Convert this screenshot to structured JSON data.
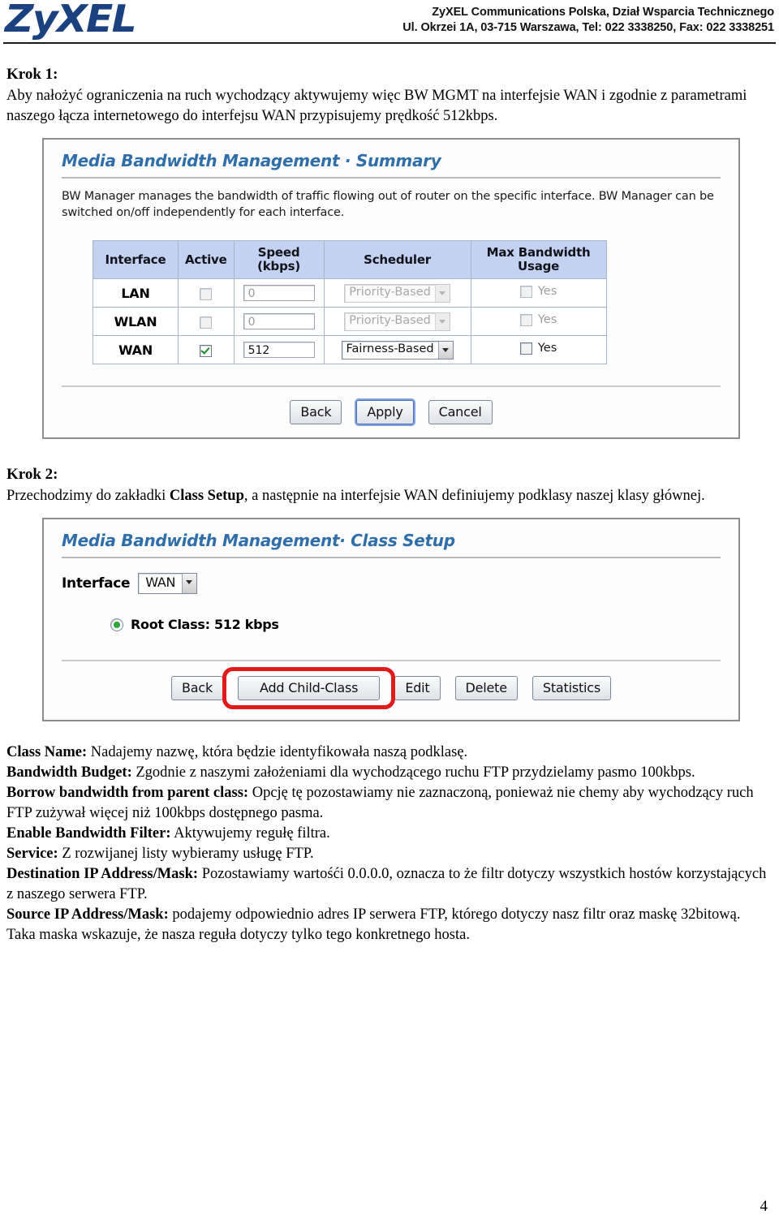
{
  "letterhead": {
    "logo_text": "ZyXEL",
    "logo_color": "#1b4180",
    "company_line1": "ZyXEL Communications Polska, Dział Wsparcia Technicznego",
    "company_line2": "Ul. Okrzei 1A, 03-715 Warszawa, Tel: 022 3338250, Fax: 022 3338251"
  },
  "step1": {
    "heading": "Krok 1:",
    "body": "Aby nałożyć ograniczenia na ruch wychodzący aktywujemy więc BW MGMT na interfejsie WAN i zgodnie z parametrami naszego łącza internetowego do interfejsu WAN przypisujemy prędkość 512kbps."
  },
  "summary_screen": {
    "title": "Media Bandwidth Management · Summary",
    "description": "BW Manager manages the bandwidth of traffic flowing out of router on the specific interface. BW Manager can be switched on/off independently for each interface.",
    "table": {
      "headers": [
        "Interface",
        "Active",
        "Speed (kbps)",
        "Scheduler",
        "Max Bandwidth Usage"
      ],
      "rows": [
        {
          "interface": "LAN",
          "active": false,
          "speed": "0",
          "speed_disabled": true,
          "scheduler": "Priority-Based",
          "scheduler_disabled": true,
          "max_bandwidth_label": "Yes",
          "max_bandwidth_checked": false,
          "max_bandwidth_disabled": true
        },
        {
          "interface": "WLAN",
          "active": false,
          "speed": "0",
          "speed_disabled": true,
          "scheduler": "Priority-Based",
          "scheduler_disabled": true,
          "max_bandwidth_label": "Yes",
          "max_bandwidth_checked": false,
          "max_bandwidth_disabled": true
        },
        {
          "interface": "WAN",
          "active": true,
          "speed": "512",
          "speed_disabled": false,
          "scheduler": "Fairness-Based",
          "scheduler_disabled": false,
          "max_bandwidth_label": "Yes",
          "max_bandwidth_checked": false,
          "max_bandwidth_disabled": false
        }
      ]
    },
    "buttons": [
      {
        "label": "Back",
        "focused": false
      },
      {
        "label": "Apply",
        "focused": true
      },
      {
        "label": "Cancel",
        "focused": false
      }
    ]
  },
  "step2": {
    "heading": "Krok 2:",
    "body_part1": "Przechodzimy do zakładki ",
    "body_bold": "Class Setup",
    "body_part2": ", a następnie na interfejsie WAN definiujemy podklasy naszej klasy głównej."
  },
  "class_setup_screen": {
    "title": "Media Bandwidth Management· Class Setup",
    "interface_label": "Interface",
    "interface_value": "WAN",
    "root_class_label": "Root Class: 512 kbps",
    "root_class_selected": true,
    "buttons": [
      {
        "label": "Back",
        "highlighted": false
      },
      {
        "label": "Add Child-Class",
        "highlighted": true
      },
      {
        "label": "Edit",
        "highlighted": false
      },
      {
        "label": "Delete",
        "highlighted": false
      },
      {
        "label": "Statistics",
        "highlighted": false
      }
    ],
    "highlight_color": "#e01b1b"
  },
  "definitions": [
    {
      "term": "Class Name:",
      "text": " Nadajemy nazwę, która będzie identyfikowała naszą podklasę."
    },
    {
      "term": "Bandwidth Budget:",
      "text": " Zgodnie z naszymi założeniami dla wychodzącego ruchu FTP przydzielamy pasmo 100kbps."
    },
    {
      "term": "Borrow bandwidth from parent class:",
      "text": " Opcję tę pozostawiamy nie zaznaczoną, ponieważ nie chemy aby wychodzący ruch FTP zużywał więcej niż 100kbps dostępnego pasma."
    },
    {
      "term": "Enable Bandwidth Filter:",
      "text": " Aktywujemy regułę filtra."
    },
    {
      "term": "Service:",
      "text": " Z rozwijanej listy wybieramy usługę FTP."
    },
    {
      "term": "Destination IP Address/Mask:",
      "text": " Pozostawiamy wartośći 0.0.0.0, oznacza to że filtr dotyczy wszystkich hostów korzystających z naszego serwera FTP."
    },
    {
      "term": "Source IP Address/Mask:",
      "text": " podajemy odpowiednio adres IP serwera FTP, którego dotyczy nasz filtr oraz maskę 32bitową. Taka maska wskazuje, że nasza reguła dotyczy tylko tego konkretnego hosta."
    }
  ],
  "page_number": "4"
}
